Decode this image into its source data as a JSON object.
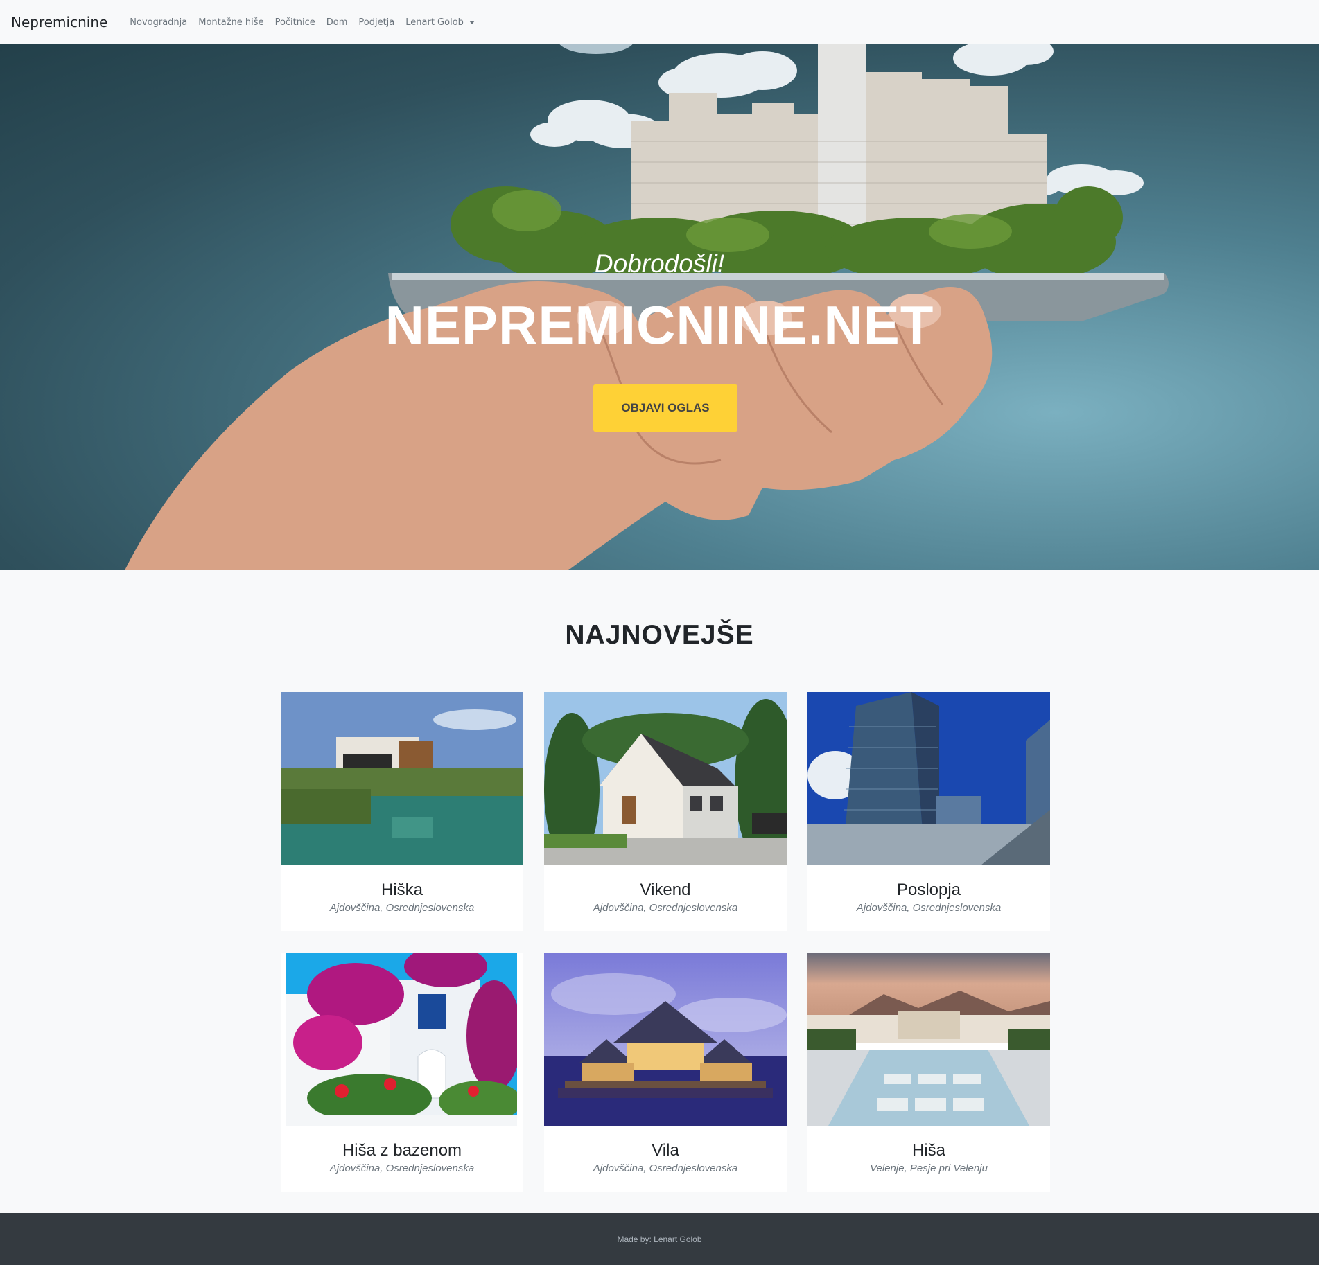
{
  "navbar": {
    "brand": "Nepremicnine",
    "items": [
      "Novogradnja",
      "Montažne hiše",
      "Počitnice",
      "Dom",
      "Podjetja"
    ],
    "user": "Lenart Golob"
  },
  "hero": {
    "subtitle": "Dobrodošli!",
    "title": "NEPREMICNINE.NET",
    "button": "OBJAVI OGLAS"
  },
  "latest": {
    "heading": "NAJNOVEJŠE",
    "listings": [
      {
        "title": "Hiška",
        "location": "Ajdovščina, Osrednjeslovenska"
      },
      {
        "title": "Vikend",
        "location": "Ajdovščina, Osrednjeslovenska"
      },
      {
        "title": "Poslopja",
        "location": "Ajdovščina, Osrednjeslovenska"
      },
      {
        "title": "Hiša z bazenom",
        "location": "Ajdovščina, Osrednjeslovenska"
      },
      {
        "title": "Vila",
        "location": "Ajdovščina, Osrednjeslovenska"
      },
      {
        "title": "Hiša",
        "location": "Velenje, Pesje pri Velenju"
      }
    ]
  },
  "footer": {
    "text": "Made by: Lenart Golob"
  },
  "colors": {
    "accent": "#fed136",
    "footer_bg": "#343a40",
    "page_bg": "#f8f9fa"
  }
}
